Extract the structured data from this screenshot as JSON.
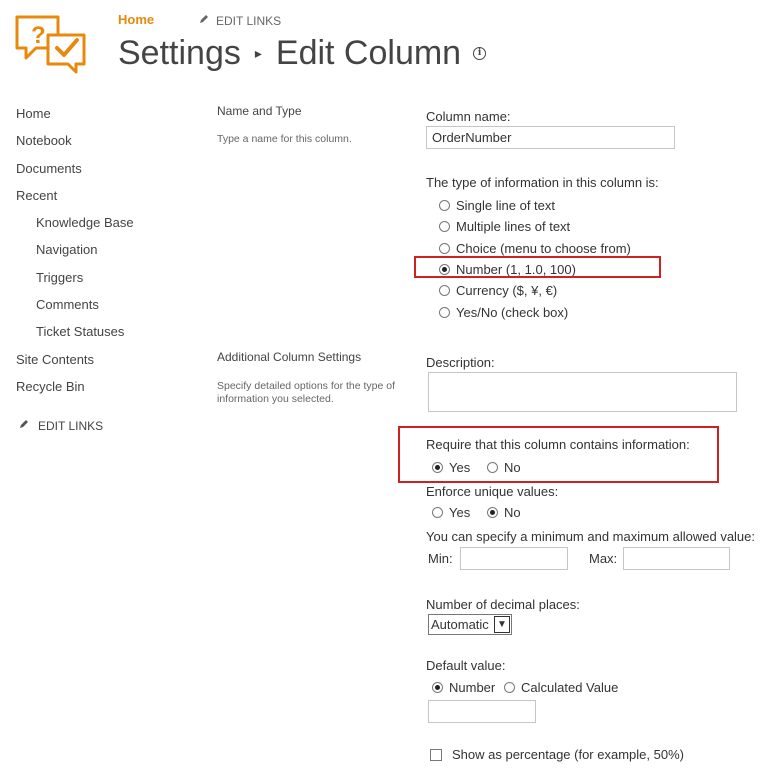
{
  "header": {
    "home_link": "Home",
    "edit_links": "EDIT LINKS",
    "title_part1": "Settings",
    "title_sep": "▸",
    "title_part2": "Edit Column",
    "info_icon": "i"
  },
  "nav": {
    "items": [
      {
        "label": "Home"
      },
      {
        "label": "Notebook"
      },
      {
        "label": "Documents"
      },
      {
        "label": "Recent"
      },
      {
        "label": "Knowledge Base"
      },
      {
        "label": "Navigation"
      },
      {
        "label": "Triggers"
      },
      {
        "label": "Comments"
      },
      {
        "label": "Ticket Statuses"
      },
      {
        "label": "Site Contents"
      },
      {
        "label": "Recycle Bin"
      }
    ],
    "edit_links": "EDIT LINKS"
  },
  "sections": {
    "name_type": {
      "title": "Name and Type",
      "desc": "Type a name for this column."
    },
    "additional": {
      "title": "Additional Column Settings",
      "desc": "Specify detailed options for the type of information you selected."
    }
  },
  "form": {
    "column_name_label": "Column name:",
    "column_name_value": "OrderNumber",
    "type_label": "The type of information in this column is:",
    "types": [
      {
        "label": "Single line of text",
        "checked": false
      },
      {
        "label": "Multiple lines of text",
        "checked": false
      },
      {
        "label": "Choice (menu to choose from)",
        "checked": false
      },
      {
        "label": "Number (1, 1.0, 100)",
        "checked": true
      },
      {
        "label": "Currency ($, ¥, €)",
        "checked": false
      },
      {
        "label": "Yes/No (check box)",
        "checked": false
      }
    ],
    "description_label": "Description:",
    "require_label": "Require that this column contains information:",
    "require_yes": "Yes",
    "require_no": "No",
    "require_value": "Yes",
    "unique_label": "Enforce unique values:",
    "unique_yes": "Yes",
    "unique_no": "No",
    "unique_value": "No",
    "minmax_label": "You can specify a minimum and maximum allowed value:",
    "min_label": "Min:",
    "max_label": "Max:",
    "min_value": "",
    "max_value": "",
    "decimal_label": "Number of decimal places:",
    "decimal_value": "Automatic",
    "default_label": "Default value:",
    "default_number": "Number",
    "default_calculated": "Calculated Value",
    "default_value_mode": "Number",
    "default_value": "",
    "percent_label": "Show as percentage (for example, 50%)",
    "percent_checked": false
  },
  "colors": {
    "accent": "#e8890c",
    "highlight": "#cc2222"
  }
}
